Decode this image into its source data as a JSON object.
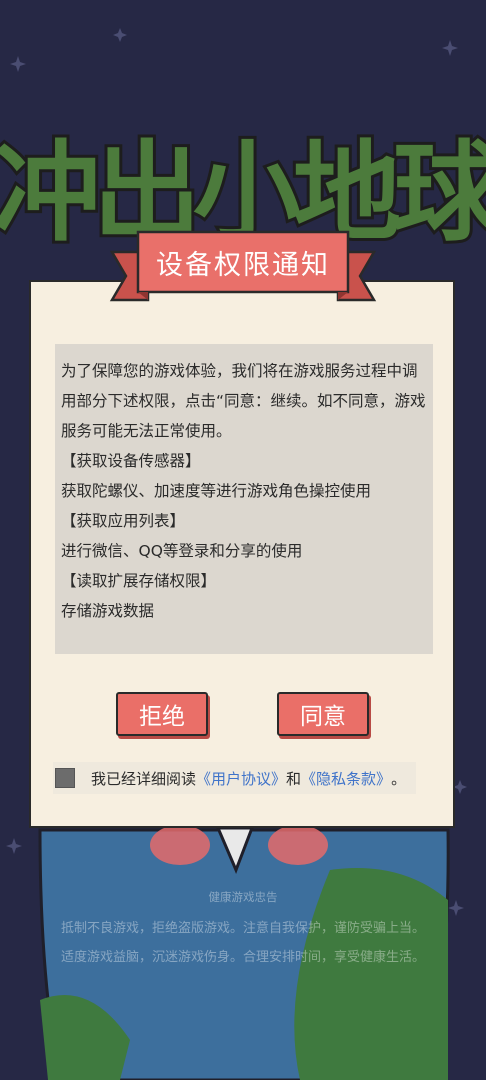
{
  "game": {
    "logo_text": "冲出小地球"
  },
  "dialog": {
    "title": "设备权限通知",
    "paragraphs": [
      "为了保障您的游戏体验，我们将在游戏服务过程中调用部分下述权限，点击“同意：继续。如不同意，游戏服务可能无法正常使用。",
      "【获取设备传感器】",
      "获取陀螺仪、加速度等进行游戏角色操控使用",
      "【获取应用列表】",
      "进行微信、QQ等登录和分享的使用",
      "【读取扩展存储权限】",
      "存储游戏数据"
    ],
    "reject_label": "拒绝",
    "agree_label": "同意",
    "consent_prefix": "我已经详细阅读",
    "user_agreement_link": "《用户协议》",
    "consent_and": "和",
    "privacy_link": "《隐私条款》",
    "consent_suffix": "。"
  },
  "health_notice": {
    "title": "健康游戏忠告",
    "line1": "抵制不良游戏，拒绝盗版游戏。注意自我保护，谨防受骗上当。",
    "line2": "适度游戏益脑，沉迷游戏伤身。合理安排时间，享受健康生活。"
  },
  "colors": {
    "accent": "#ea6f68",
    "background": "#262845",
    "dialog": "#f7efe0",
    "link": "#3f73c9",
    "logo": "#4a7a3a"
  }
}
